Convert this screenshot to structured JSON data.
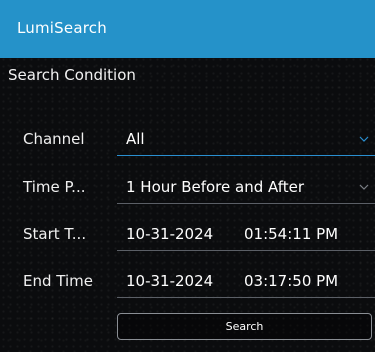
{
  "app": {
    "title": "LumiSearch",
    "accent_color": "#2592c9"
  },
  "search_condition": {
    "title": "Search Condition",
    "channel": {
      "label": "Channel",
      "value": "All",
      "icon": "chevron-down-icon"
    },
    "time_period": {
      "label": "Time P...",
      "value": "1 Hour Before and After",
      "icon": "chevron-down-icon"
    },
    "start_time": {
      "label": "Start T...",
      "date": "10-31-2024",
      "time": "01:54:11 PM"
    },
    "end_time": {
      "label": "End Time",
      "date": "10-31-2024",
      "time": "03:17:50 PM"
    },
    "search_button": "Search"
  }
}
